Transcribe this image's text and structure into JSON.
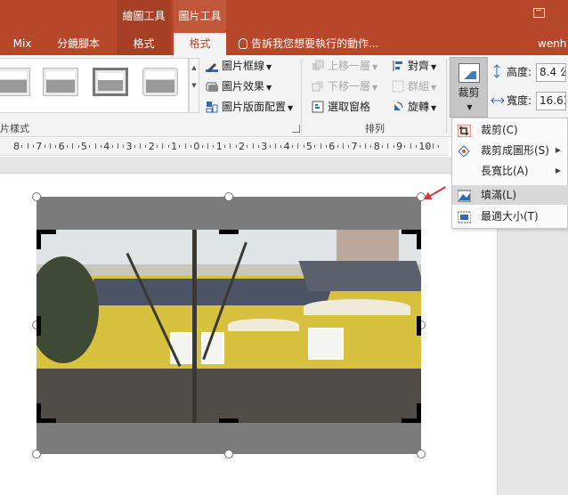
{
  "titlebar": {
    "contextual_groups": [
      "繪圖工具",
      "圖片工具"
    ],
    "tabs": [
      "Mix",
      "分鏡腳本",
      "格式",
      "格式"
    ],
    "tell_me": "告訴我您想要執行的動作...",
    "user": "wenh"
  },
  "ribbon": {
    "picture_styles_label": "片樣式",
    "picture_border": "圖片框線",
    "picture_effects": "圖片效果",
    "picture_layout": "圖片版面配置",
    "bring_forward": "上移一層",
    "send_backward": "下移一層",
    "selection_pane": "選取窗格",
    "align": "對齊",
    "group": "群組",
    "rotate": "旋轉",
    "arrange_label": "排列",
    "crop": "裁剪",
    "height_label": "高度:",
    "height_value": "8.4 公",
    "width_label": "寬度:",
    "width_value": "16.63"
  },
  "ruler": {
    "numbers": [
      "8",
      "7",
      "6",
      "5",
      "4",
      "3",
      "2",
      "1",
      "0",
      "1",
      "2",
      "3",
      "4",
      "5",
      "6",
      "7",
      "8",
      "9",
      "10"
    ]
  },
  "crop_menu": {
    "items": [
      {
        "label": "裁剪(C)",
        "icon": "crop-icon",
        "submenu": false
      },
      {
        "label": "裁剪成圖形(S)",
        "icon": "crop-to-shape-icon",
        "submenu": true
      },
      {
        "label": "長寬比(A)",
        "icon": "",
        "submenu": true
      },
      {
        "label": "填滿(L)",
        "icon": "fill-icon",
        "submenu": false,
        "active": true
      },
      {
        "label": "最適大小(T)",
        "icon": "fit-icon",
        "submenu": false
      }
    ]
  },
  "colors": {
    "accent": "#b7472a",
    "ribbon_bg": "#f3f3f3",
    "arrow": "#dd3333"
  }
}
